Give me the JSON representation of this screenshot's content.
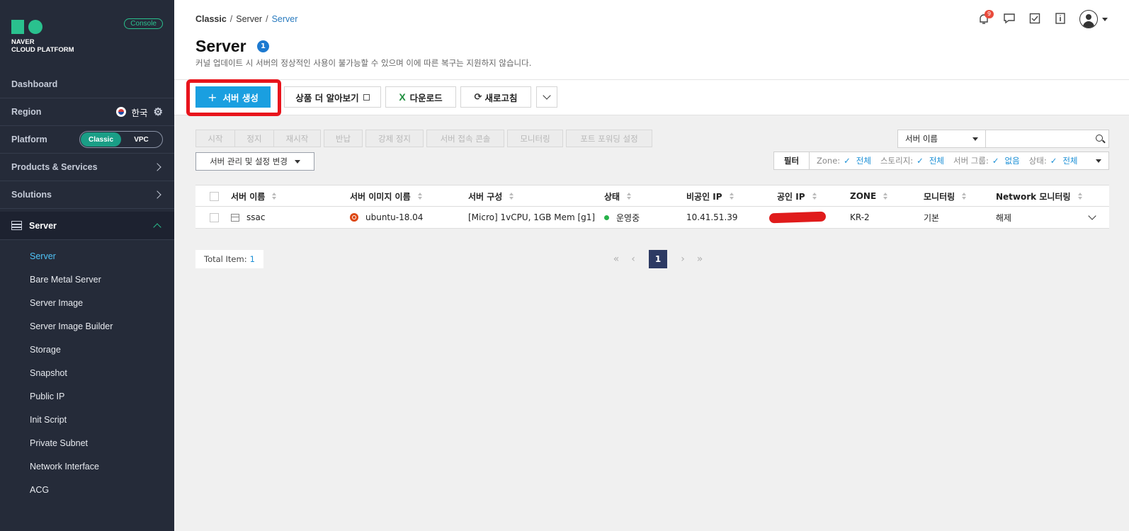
{
  "sidebar": {
    "logo_line1": "NAVER",
    "logo_line2": "CLOUD PLATFORM",
    "console_badge": "Console",
    "dashboard": "Dashboard",
    "region_label": "Region",
    "region_value": "한국",
    "platform_label": "Platform",
    "platform_options": [
      "Classic",
      "VPC"
    ],
    "platform_selected": "Classic",
    "products": "Products & Services",
    "solutions": "Solutions",
    "server_section": "Server",
    "sub_items": [
      "Server",
      "Bare Metal Server",
      "Server Image",
      "Server Image Builder",
      "Storage",
      "Snapshot",
      "Public IP",
      "Init Script",
      "Private Subnet",
      "Network Interface",
      "ACG"
    ],
    "active_sub_item": "Server"
  },
  "header": {
    "breadcrumb": [
      "Classic",
      "Server",
      "Server"
    ],
    "notification_count": "9"
  },
  "page": {
    "title": "Server",
    "title_badge": "1",
    "notice": "커널 업데이트 시 서버의 정상적인 사용이 불가능할 수 있으며 이에 따른 복구는 지원하지 않습니다."
  },
  "toolbar": {
    "create_label": "서버 생성",
    "learn_more": "상품 더 알아보기",
    "download": "다운로드",
    "refresh": "새로고침"
  },
  "actions": [
    "시작",
    "정지",
    "재시작",
    "반납",
    "강제 정지",
    "서버 접속 콘솔",
    "모니터링",
    "포트 포워딩 설정"
  ],
  "manage_button": "서버 관리 및 설정 변경",
  "search": {
    "field": "서버 이름",
    "value": ""
  },
  "filters": {
    "label": "필터",
    "items": [
      {
        "name": "Zone:",
        "value": "전체"
      },
      {
        "name": "스토리지:",
        "value": "전체"
      },
      {
        "name": "서버 그룹:",
        "value": "없음"
      },
      {
        "name": "상태:",
        "value": "전체"
      }
    ]
  },
  "table": {
    "columns": [
      "서버 이름",
      "서버 이미지 이름",
      "서버 구성",
      "상태",
      "비공인 IP",
      "공인 IP",
      "ZONE",
      "모니터링",
      "Network 모니터링"
    ],
    "rows": [
      {
        "name": "ssac",
        "image": "ubuntu-18.04",
        "spec": "[Micro] 1vCPU, 1GB Mem [g1]",
        "status": "운영중",
        "private_ip": "10.41.51.39",
        "zone": "KR-2",
        "monitoring": "기본",
        "network_monitoring": "해제"
      }
    ]
  },
  "footer": {
    "total_label": "Total Item:",
    "total_count": "1",
    "current_page": "1"
  },
  "colors": {
    "sidebar_bg": "#252b39",
    "accent_green": "#2ac18e",
    "create_button": "#1a9fe0",
    "highlight_red": "#e8141c",
    "active_link": "#4fc3f7",
    "status_running": "#27b24a"
  }
}
